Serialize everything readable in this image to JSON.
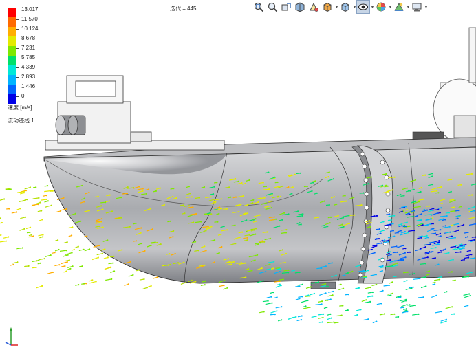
{
  "legend": {
    "ticks": [
      "13.017",
      "11.570",
      "10.124",
      "8.678",
      "7.231",
      "5.785",
      "4.339",
      "2.893",
      "1.446",
      "0"
    ],
    "colors": [
      "#ff0000",
      "#ff6a00",
      "#ffae00",
      "#e3ea00",
      "#7fe800",
      "#00e06a",
      "#00e8d8",
      "#00b4ff",
      "#0064ff",
      "#0000e6"
    ],
    "unit": "速度 [m/s]",
    "name": "流动迹线 1"
  },
  "status": {
    "iteration": "迭代 = 445"
  },
  "toolbar": {
    "items": [
      "zoom-to-fit-icon",
      "zoom-area-icon",
      "previous-view-icon",
      "section-view-icon",
      "dynamic-annotation-icon",
      "view-orientation-icon",
      "display-style-icon",
      "hide-show-items-icon",
      "edit-appearance-icon",
      "apply-scene-icon",
      "view-settings-icon"
    ]
  },
  "colors": {
    "hull": "#c8c9cc",
    "hull_dark": "#8e9095",
    "background": "#ffffff"
  }
}
